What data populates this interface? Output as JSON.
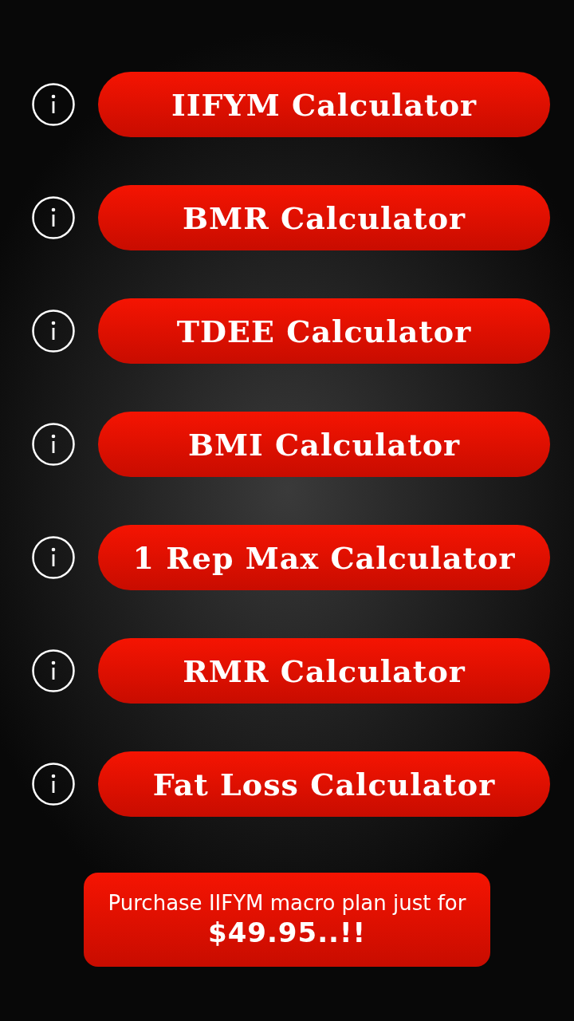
{
  "calculators": [
    {
      "label": "IIFYM Calculator"
    },
    {
      "label": "BMR Calculator"
    },
    {
      "label": "TDEE Calculator"
    },
    {
      "label": "BMI Calculator"
    },
    {
      "label": "1 Rep Max Calculator"
    },
    {
      "label": "RMR Calculator"
    },
    {
      "label": "Fat Loss Calculator"
    }
  ],
  "purchase": {
    "text": "Purchase IIFYM macro plan just for",
    "price": "$49.95..!!"
  }
}
